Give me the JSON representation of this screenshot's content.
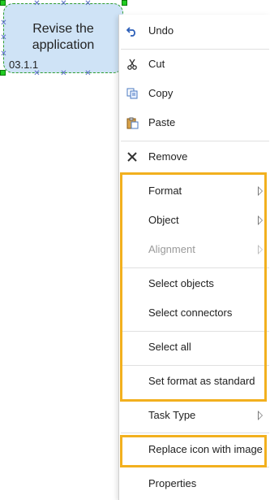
{
  "shape": {
    "title": "Revise the application",
    "id": "03.1.1"
  },
  "menu": {
    "undo": "Undo",
    "cut": "Cut",
    "copy": "Copy",
    "paste": "Paste",
    "remove": "Remove",
    "format": "Format",
    "object": "Object",
    "alignment": "Alignment",
    "select_objects": "Select objects",
    "select_connectors": "Select connectors",
    "select_all": "Select all",
    "set_format_standard": "Set format as standard",
    "task_type": "Task Type",
    "replace_icon": "Replace icon with image",
    "properties": "Properties"
  },
  "colors": {
    "highlight": "#f2b01e",
    "shape_fill": "#cfe3f6",
    "shape_border": "#2f9e2f"
  },
  "icons": {
    "undo": "undo-icon",
    "cut": "scissors-icon",
    "copy": "copy-icon",
    "paste": "clipboard-icon",
    "remove": "x-icon"
  }
}
